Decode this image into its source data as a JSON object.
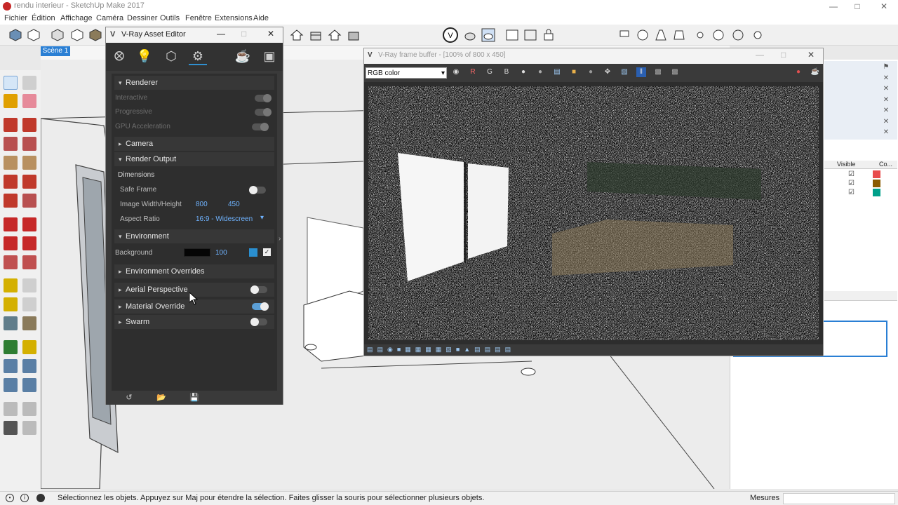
{
  "window": {
    "title": "rendu interieur - SketchUp Make 2017",
    "controls": [
      "—",
      "□",
      "✕"
    ]
  },
  "menu": [
    "Fichier",
    "Édition",
    "Affichage",
    "Caméra",
    "Dessiner",
    "Outils",
    "Fenêtre",
    "Extensions",
    "Aide"
  ],
  "scene_tab": "Scène 1",
  "asset_editor": {
    "title": "V-Ray Asset Editor",
    "renderer_section": "Renderer",
    "interactive": "Interactive",
    "progressive": "Progressive",
    "gpu": "GPU Acceleration",
    "camera_section": "Camera",
    "render_output_section": "Render Output",
    "dimensions": "Dimensions",
    "safe_frame": "Safe Frame",
    "image_wh": "Image Width/Height",
    "width": "800",
    "height": "450",
    "aspect_ratio": "Aspect Ratio",
    "aspect_value": "16:9 - Widescreen",
    "environment_section": "Environment",
    "background": "Background",
    "background_value": "100",
    "env_overrides": "Environment Overrides",
    "aerial": "Aerial Perspective",
    "material_override": "Material Override",
    "swarm": "Swarm"
  },
  "frame_buffer": {
    "title": "V-Ray frame buffer - [100% of 800 x 450]",
    "channel": "RGB color",
    "r": "R",
    "g": "G",
    "b": "B"
  },
  "right_panel": {
    "visible": "Visible",
    "color": "Co..."
  },
  "status": {
    "message": "Sélectionnez les objets. Appuyez sur Maj pour étendre la sélection. Faites glisser la souris pour sélectionner plusieurs objets.",
    "measures": "Mesures"
  },
  "colors": {
    "accent": "#2f8fd0",
    "layer_1": "#e84c4c",
    "layer_2": "#8a5a00",
    "layer_3": "#00a08a"
  }
}
